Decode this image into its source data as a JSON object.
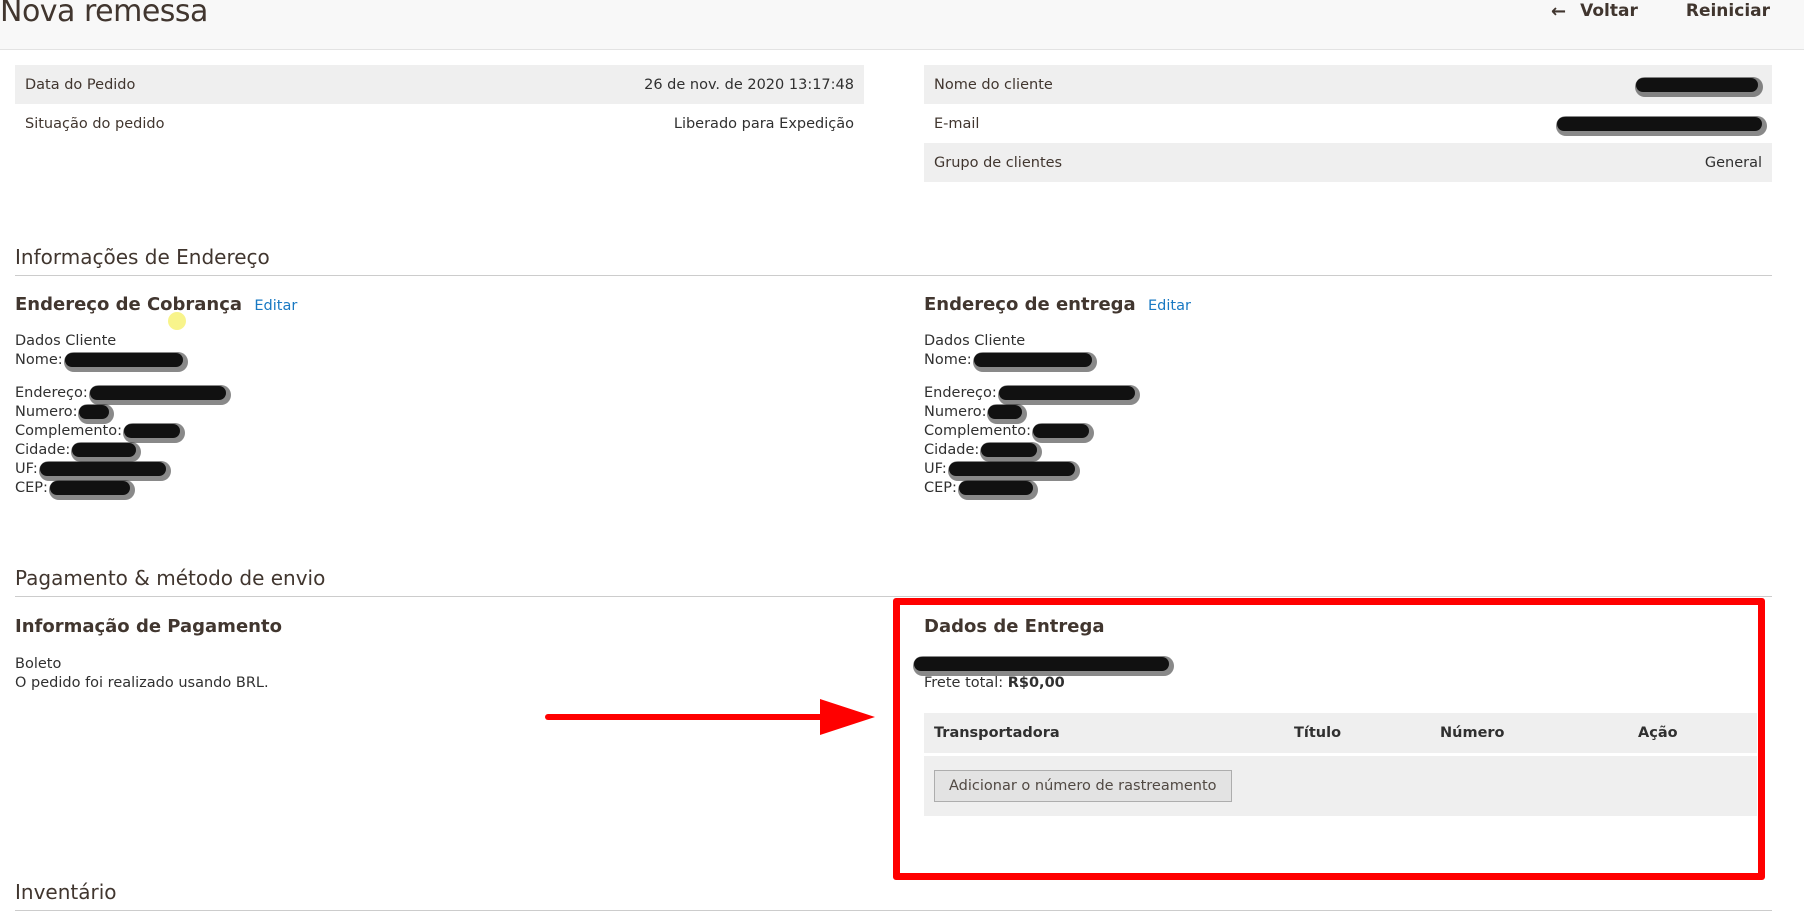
{
  "header": {
    "title": "Nova remessa",
    "back_label": "Voltar",
    "reset_label": "Reiniciar"
  },
  "order_info": {
    "date_label": "Data do Pedido",
    "date_value": "26 de nov. de 2020 13:17:48",
    "status_label": "Situação do pedido",
    "status_value": "Liberado para Expedição"
  },
  "customer_info": {
    "name_label": "Nome do cliente",
    "email_label": "E-mail",
    "group_label": "Grupo de clientes",
    "group_value": "General"
  },
  "address_section": {
    "title": "Informações de Endereço",
    "billing": {
      "title": "Endereço de Cobrança",
      "edit_label": "Editar",
      "heading": "Dados Cliente",
      "name_label": "Nome:",
      "street_label": "Endereço:",
      "number_label": "Numero:",
      "complement_label": "Complemento:",
      "city_label": "Cidade:",
      "state_label": "UF:",
      "zip_label": "CEP:"
    },
    "shipping": {
      "title": "Endereço de entrega",
      "edit_label": "Editar",
      "heading": "Dados Cliente",
      "name_label": "Nome:",
      "street_label": "Endereço:",
      "number_label": "Numero:",
      "complement_label": "Complemento:",
      "city_label": "Cidade:",
      "state_label": "UF:",
      "zip_label": "CEP:"
    }
  },
  "payment_section": {
    "title": "Pagamento & método de envio",
    "payment": {
      "title": "Informação de Pagamento",
      "method": "Boleto",
      "currency_note": "O pedido foi realizado usando BRL."
    },
    "delivery": {
      "title": "Dados de Entrega",
      "freight_label": "Frete total:",
      "freight_value": "R$0,00",
      "columns": [
        "Transportadora",
        "Título",
        "Número",
        "Ação"
      ],
      "add_tracking_label": "Adicionar o número de rastreamento"
    }
  },
  "inventory_section": {
    "title": "Inventário"
  },
  "annotation_color": "#ff0000"
}
